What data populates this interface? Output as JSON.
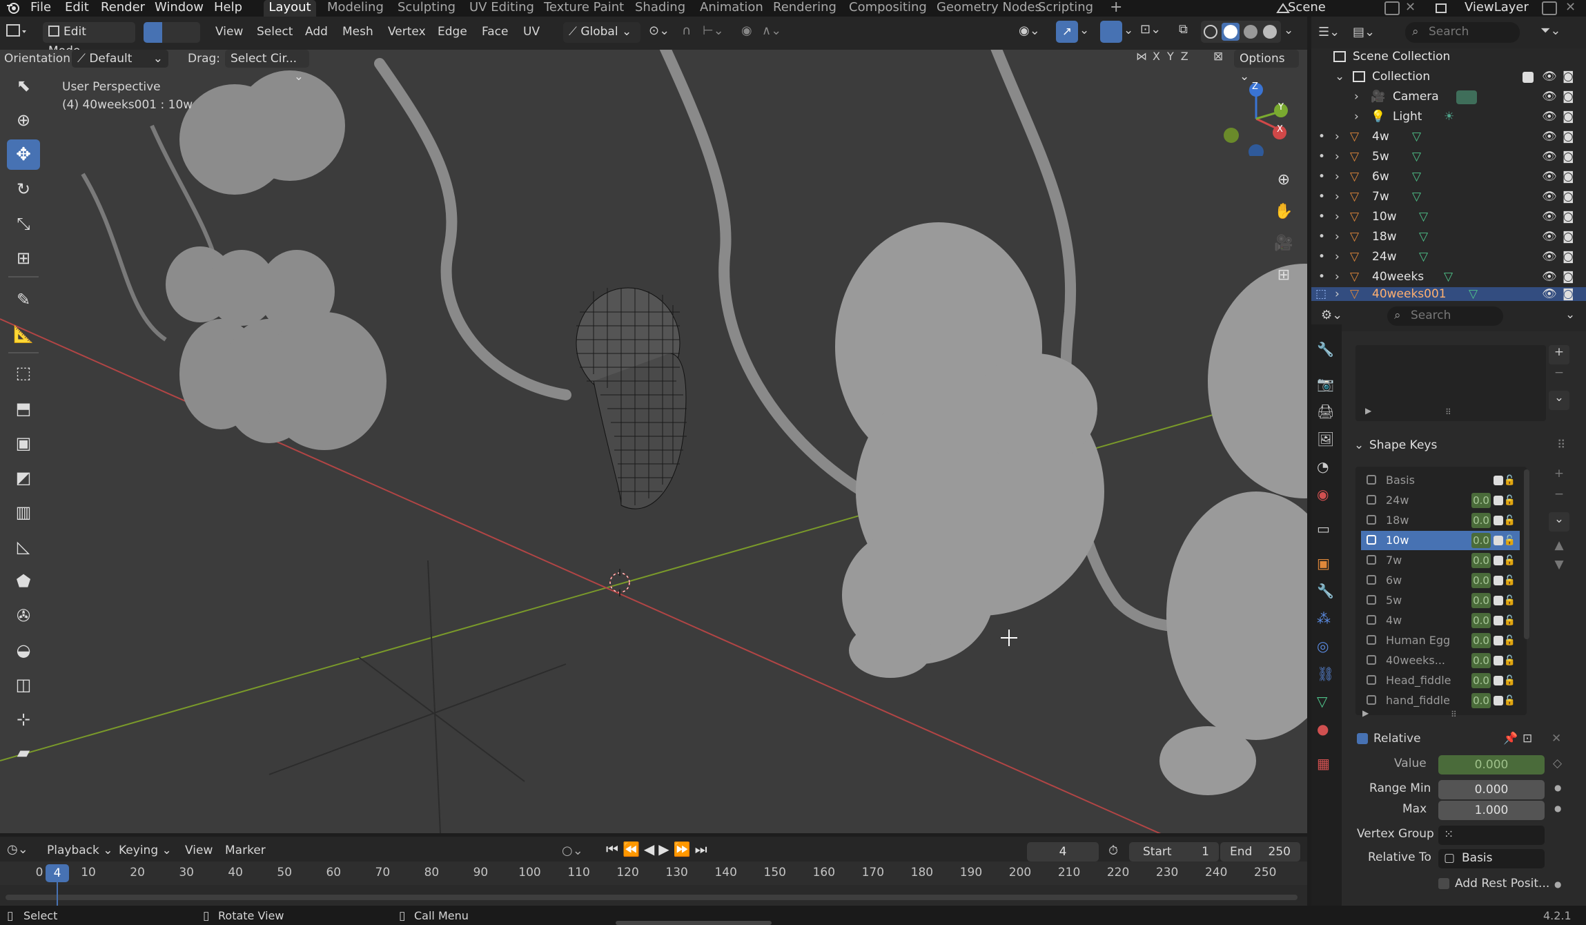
{
  "menubar": {
    "items": [
      "File",
      "Edit",
      "Render",
      "Window",
      "Help"
    ],
    "workspaces": [
      "Layout",
      "Modeling",
      "Sculpting",
      "UV Editing",
      "Texture Paint",
      "Shading",
      "Animation",
      "Rendering",
      "Compositing",
      "Geometry Nodes",
      "Scripting"
    ],
    "active_workspace": "Layout",
    "add_tab": "+",
    "scene_label": "Scene",
    "viewlayer_label": "ViewLayer"
  },
  "viewport_header": {
    "mode": "Edit Mode",
    "menus": [
      "View",
      "Select",
      "Add",
      "Mesh",
      "Vertex",
      "Edge",
      "Face",
      "UV"
    ],
    "transform_orientation": "Global",
    "options_label": "Options",
    "axes": [
      "X",
      "Y",
      "Z"
    ]
  },
  "tool_settings": {
    "orientation_label": "Orientation:",
    "orientation_value": "Default",
    "drag_label": "Drag:",
    "drag_value": "Select Cir..."
  },
  "viewport": {
    "perspective": "User Perspective",
    "object_info": "(4) 40weeks001 : 10w",
    "gizmo": {
      "z": "Z",
      "y": "Y",
      "x": "X"
    }
  },
  "toolbar_tools": [
    "select-box",
    "cursor",
    "move",
    "rotate",
    "scale",
    "transform",
    "annotate",
    "measure",
    "add-cube",
    "extrude",
    "inset",
    "bevel",
    "loop-cut",
    "knife",
    "poly-build",
    "spin",
    "smooth",
    "edge-slide",
    "shrink-fatten",
    "shear",
    "rip"
  ],
  "outliner": {
    "search_placeholder": "Search",
    "scene_collection": "Scene Collection",
    "collection": "Collection",
    "items": [
      {
        "name": "Camera",
        "type": "camera"
      },
      {
        "name": "Light",
        "type": "light"
      },
      {
        "name": "4w",
        "type": "mesh"
      },
      {
        "name": "5w",
        "type": "mesh"
      },
      {
        "name": "6w",
        "type": "mesh"
      },
      {
        "name": "7w",
        "type": "mesh"
      },
      {
        "name": "10w",
        "type": "mesh"
      },
      {
        "name": "18w",
        "type": "mesh"
      },
      {
        "name": "24w",
        "type": "mesh"
      },
      {
        "name": "40weeks",
        "type": "mesh"
      },
      {
        "name": "40weeks001",
        "type": "mesh",
        "selected": true
      }
    ]
  },
  "properties": {
    "search_placeholder": "Search",
    "shape_keys_title": "Shape Keys",
    "shape_keys": [
      {
        "name": "Basis",
        "value": ""
      },
      {
        "name": "24w",
        "value": "0.0"
      },
      {
        "name": "18w",
        "value": "0.0"
      },
      {
        "name": "10w",
        "value": "0.0",
        "active": true
      },
      {
        "name": "7w",
        "value": "0.0"
      },
      {
        "name": "6w",
        "value": "0.0"
      },
      {
        "name": "5w",
        "value": "0.0"
      },
      {
        "name": "4w",
        "value": "0.0"
      },
      {
        "name": "Human Egg",
        "value": "0.0"
      },
      {
        "name": "40weeks...",
        "value": "0.0"
      },
      {
        "name": "Head_fiddle",
        "value": "0.0"
      },
      {
        "name": "hand_fiddle",
        "value": "0.0"
      }
    ],
    "relative_label": "Relative",
    "value_label": "Value",
    "value": "0.000",
    "range_min_label": "Range Min",
    "range_min": "0.000",
    "max_label": "Max",
    "max": "1.000",
    "vertex_group_label": "Vertex Group",
    "relative_to_label": "Relative To",
    "relative_to": "Basis",
    "add_rest_label": "Add Rest Posit..."
  },
  "timeline": {
    "menus": [
      "Playback",
      "Keying",
      "View",
      "Marker"
    ],
    "current_frame": "4",
    "start_label": "Start",
    "start": "1",
    "end_label": "End",
    "end": "250",
    "ticks": [
      "0",
      "10",
      "20",
      "30",
      "40",
      "50",
      "60",
      "70",
      "80",
      "90",
      "100",
      "110",
      "120",
      "130",
      "140",
      "150",
      "160",
      "170",
      "180",
      "190",
      "200",
      "210",
      "220",
      "230",
      "240",
      "250"
    ]
  },
  "statusbar": {
    "select": "Select",
    "rotate_view": "Rotate View",
    "call_menu": "Call Menu",
    "version": "4.2.1"
  },
  "colors": {
    "accent": "#4772b3",
    "x_axis": "#c24a4a",
    "y_axis": "#7a9a2a",
    "selection": "#334d80"
  }
}
